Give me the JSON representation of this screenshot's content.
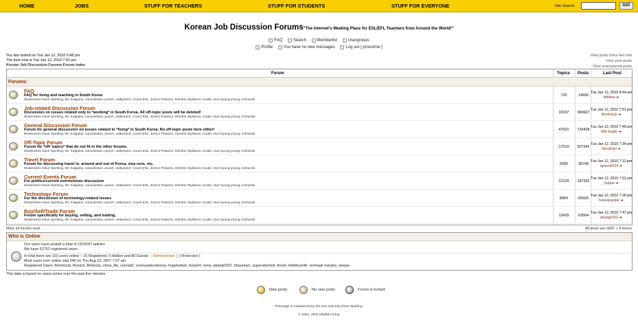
{
  "nav": {
    "items": [
      "HOME",
      "JOBS",
      "STUFF FOR TEACHERS",
      "STUFF FOR STUDENTS",
      "STUFF FOR EVERYONE"
    ],
    "search_label": "Site Search:",
    "search_value": "",
    "go_label": "GO!"
  },
  "header": {
    "title": "Korean Job Discussion Forums",
    "tagline": "\"The Internet's Meeting Place for ESL/EFL Teachers from Around the World!\"",
    "menu1": [
      "FAQ",
      "Search",
      "Memberlist",
      "Usergroups"
    ],
    "menu2": [
      "Profile",
      "You have no new messages",
      "Log out [ proustme ]"
    ]
  },
  "visit": {
    "last_visit": "You last visited on Tue Jan 12, 2010 5:48 pm",
    "time_now": "The time now is Tue Jan 12, 2010 7:52 pm",
    "breadcrumb": "Korean Job Discussion Forums Forum Index",
    "links": [
      "View posts since last visit",
      "View your posts",
      "View unanswered posts"
    ]
  },
  "table": {
    "headers": {
      "forum": "Forum",
      "topics": "Topics",
      "posts": "Posts",
      "last_post": "Last Post"
    },
    "category": "Forums:",
    "moderators": "Moderators Dave Sperling, Mr. Kalguksi, canuckistan, peach, valkyrian2, Count ESL, Enrico Palazzo, Dimitris Stylianos, Kuabi, Hun Kyung-young, Koharski",
    "forums": [
      {
        "name": "FAQ",
        "desc": "FAQ for living and teaching in South Korea",
        "topics": "720",
        "posts": "14935",
        "last_date": "Tue Jan 12, 2010 8:44 am",
        "last_user": "littlelisa"
      },
      {
        "name": "Job-related Discussion Forum",
        "desc": "Discussion on issues related only to *working* in South Korea. All off-topic posts will be deleted!",
        "topics": "33337",
        "posts": "390667",
        "last_date": "Tue Jan 12, 2010 7:51 pm",
        "last_user": "AmimoUp"
      },
      {
        "name": "General Discussion Forum",
        "desc": "Forum for general discussion on issues related to *living* in South Korea. No off-topic posts here either!",
        "topics": "47631",
        "posts": "726428",
        "last_date": "Tue Jan 12, 2010 7:49 pm",
        "last_user": "War Eagle"
      },
      {
        "name": "Off-Topic Forum",
        "desc": "Forum for *off- topics* that do not fit in the other forums.",
        "topics": "17519",
        "posts": "307342",
        "last_date": "Tue Jan 12, 2010 7:34 pm",
        "last_user": "NovaKart"
      },
      {
        "name": "Travel Forum",
        "desc": "Forum for discussing travel in, around and out of Korea, visa runs, etc.",
        "topics": "5050",
        "posts": "35749",
        "last_date": "Tue Jan 12, 2010 7:12 pm",
        "last_user": "rgreen8314"
      },
      {
        "name": "Current Events Forum",
        "desc": "For politics/current events/news discussion",
        "topics": "12129",
        "posts": "197332",
        "last_date": "Tue Jan 12, 2010 7:51 pm",
        "last_user": "ytuque"
      },
      {
        "name": "Technology Forum",
        "desc": "For the discussion of technology-related issues",
        "topics": "8954",
        "posts": "65926",
        "last_date": "Tue Jan 12, 2010 7:26 pm",
        "last_user": "basexpander"
      },
      {
        "name": "Buy/Sell/Trade Forum",
        "desc": "Forum specifically for buying, selling, and trading.",
        "topics": "12429",
        "posts": "63564",
        "last_date": "Tue Jan 12, 2010 7:47 pm",
        "last_user": "pkang0202"
      }
    ],
    "mark_read": "Mark all forums read",
    "timezone": "All times are GMT + 9 Hours"
  },
  "who": {
    "title": "Who is Online",
    "line1": "Our users have posted a total of 1919187 articles",
    "line2": "We have 61752 registered users",
    "line3": "In total there are 101 users online :: 16 Registered, 5 Hidden and 80 Guests",
    "admin": "[ Administrator ]",
    "moderator": "[ Moderator ]",
    "line4": "Most users ever online was 546 on Thu Aug 23, 2007 7:07 am",
    "line5": "Registered Users: AmimoUp, Benicio, Bollocks, chica_file, conrad2, curiousaboutkorea, hugekebab, lsrupert, nena, pkang0202, Shauneyz, superuberbob, tima0, toklitbunni8, vermaak maryke, ytuque",
    "note": "This data is based on users active over the past five minutes"
  },
  "legend": {
    "new": "New posts",
    "none": "No new posts",
    "locked": "Forum is locked"
  },
  "footer": {
    "maintained": "This page is maintained by the one and only Dave Sperling.",
    "copyright": "© 2001, 2002 phpBB Group"
  }
}
